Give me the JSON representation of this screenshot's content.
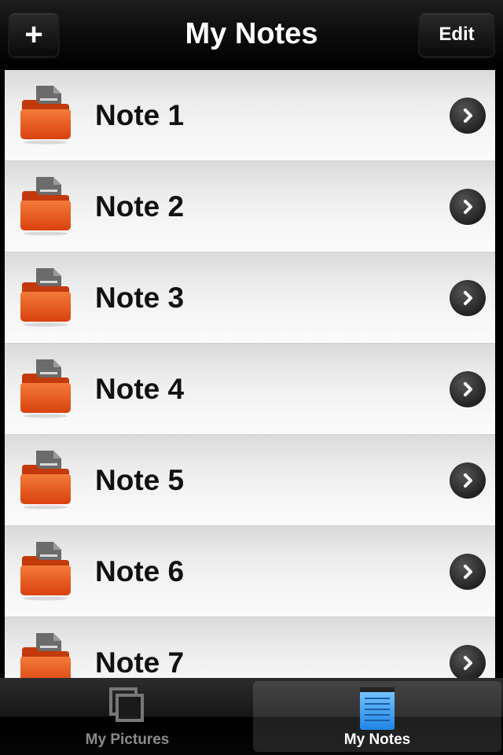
{
  "navbar": {
    "title": "My Notes",
    "add_label": "+",
    "edit_label": "Edit"
  },
  "notes": [
    {
      "label": "Note 1"
    },
    {
      "label": "Note 2"
    },
    {
      "label": "Note 3"
    },
    {
      "label": "Note 4"
    },
    {
      "label": "Note 5"
    },
    {
      "label": "Note 6"
    },
    {
      "label": "Note 7"
    }
  ],
  "icons": {
    "row_icon": "note-folder-icon",
    "disclosure": "chevron-right-icon",
    "tab_pictures": "stacked-pictures-icon",
    "tab_notes": "notepad-icon"
  },
  "tabbar": {
    "tabs": [
      {
        "label": "My Pictures",
        "selected": false
      },
      {
        "label": "My Notes",
        "selected": true
      }
    ]
  },
  "colors": {
    "folder": "#e8541c",
    "selected_tab_icon": "#3a9ff0"
  }
}
